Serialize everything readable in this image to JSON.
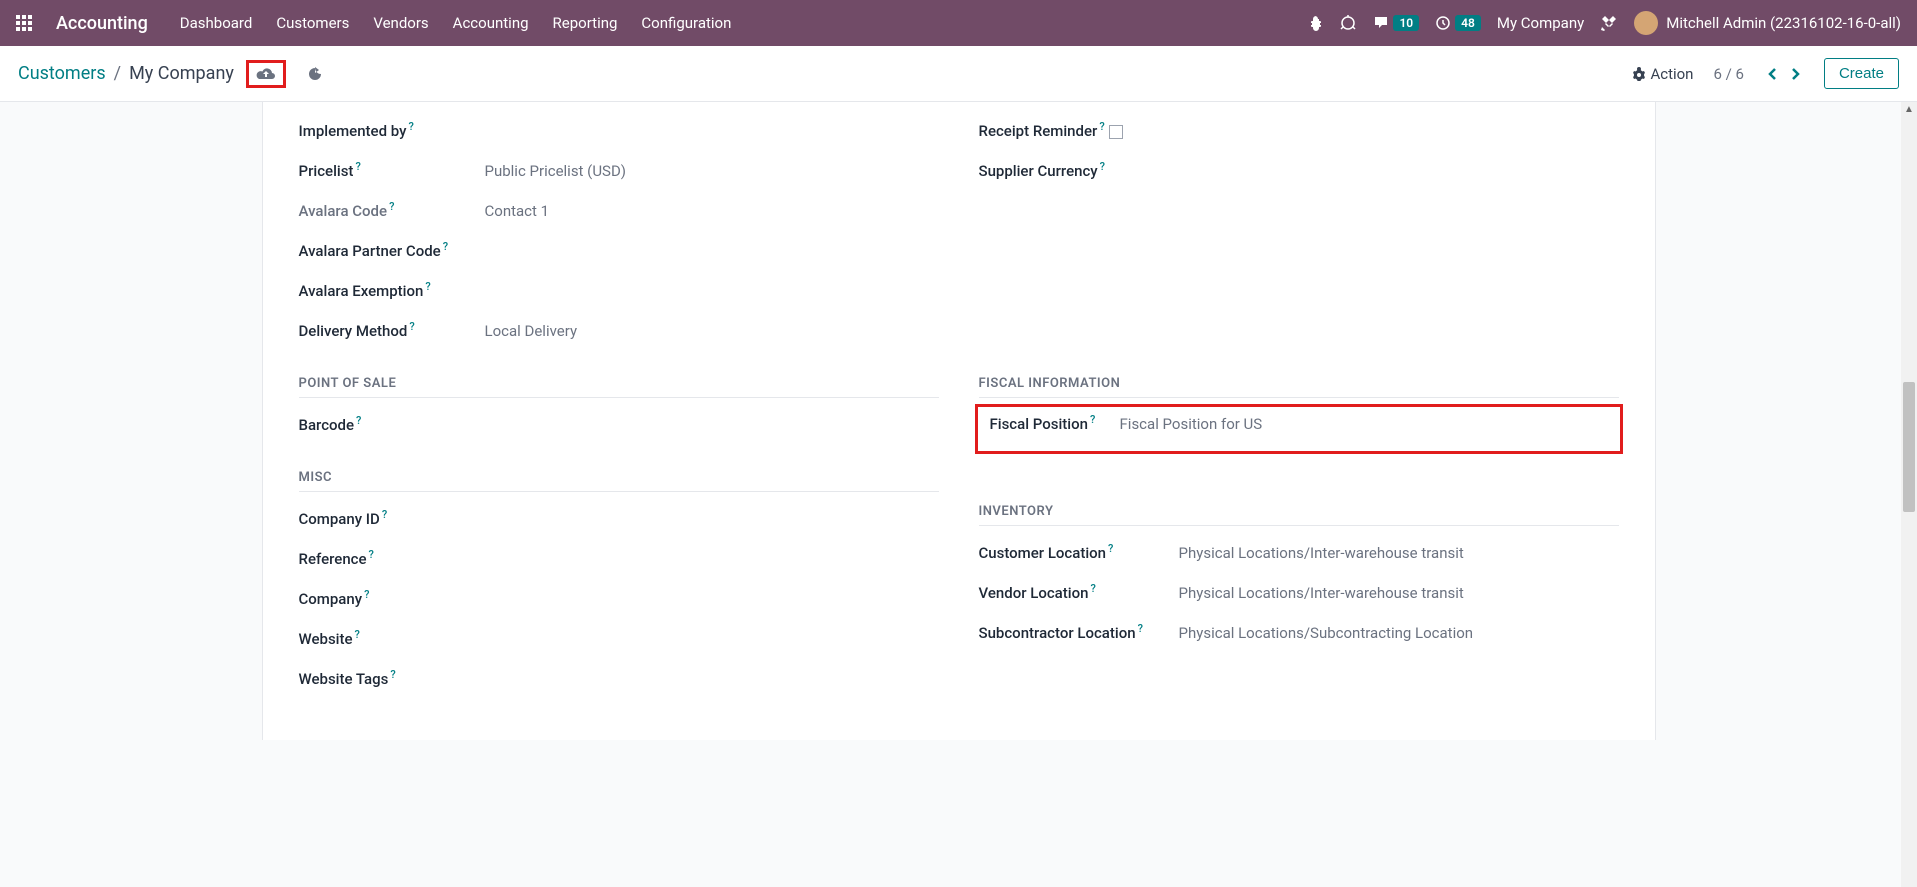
{
  "topbar": {
    "app_name": "Accounting",
    "nav": [
      "Dashboard",
      "Customers",
      "Vendors",
      "Accounting",
      "Reporting",
      "Configuration"
    ],
    "messages_badge": "10",
    "activities_badge": "48",
    "company": "My Company",
    "user": "Mitchell Admin (22316102-16-0-all)"
  },
  "subheader": {
    "breadcrumb_root": "Customers",
    "breadcrumb_current": "My Company",
    "action_label": "Action",
    "pager": "6 / 6",
    "create_label": "Create"
  },
  "left_fields": {
    "implemented_by": {
      "label": "Implemented by",
      "value": ""
    },
    "pricelist": {
      "label": "Pricelist",
      "value": "Public Pricelist (USD)"
    },
    "avalara_code": {
      "label": "Avalara Code",
      "value": "Contact 1"
    },
    "avalara_partner_code": {
      "label": "Avalara Partner Code",
      "value": ""
    },
    "avalara_exemption": {
      "label": "Avalara Exemption",
      "value": ""
    },
    "delivery_method": {
      "label": "Delivery Method",
      "value": "Local Delivery"
    }
  },
  "right_fields": {
    "receipt_reminder": {
      "label": "Receipt Reminder"
    },
    "supplier_currency": {
      "label": "Supplier Currency",
      "value": ""
    }
  },
  "sections": {
    "pos": "POINT OF SALE",
    "fiscal": "FISCAL INFORMATION",
    "misc": "MISC",
    "inventory": "INVENTORY"
  },
  "pos_fields": {
    "barcode": {
      "label": "Barcode",
      "value": ""
    }
  },
  "fiscal_fields": {
    "fiscal_position": {
      "label": "Fiscal Position",
      "value": "Fiscal Position for US"
    }
  },
  "misc_fields": {
    "company_id": {
      "label": "Company ID",
      "value": ""
    },
    "reference": {
      "label": "Reference",
      "value": ""
    },
    "company": {
      "label": "Company",
      "value": ""
    },
    "website": {
      "label": "Website",
      "value": ""
    },
    "website_tags": {
      "label": "Website Tags",
      "value": ""
    }
  },
  "inventory_fields": {
    "customer_location": {
      "label": "Customer Location",
      "value": "Physical Locations/Inter-warehouse transit"
    },
    "vendor_location": {
      "label": "Vendor Location",
      "value": "Physical Locations/Inter-warehouse transit"
    },
    "subcontractor_location": {
      "label": "Subcontractor Location",
      "value": "Physical Locations/Subcontracting Location"
    }
  }
}
